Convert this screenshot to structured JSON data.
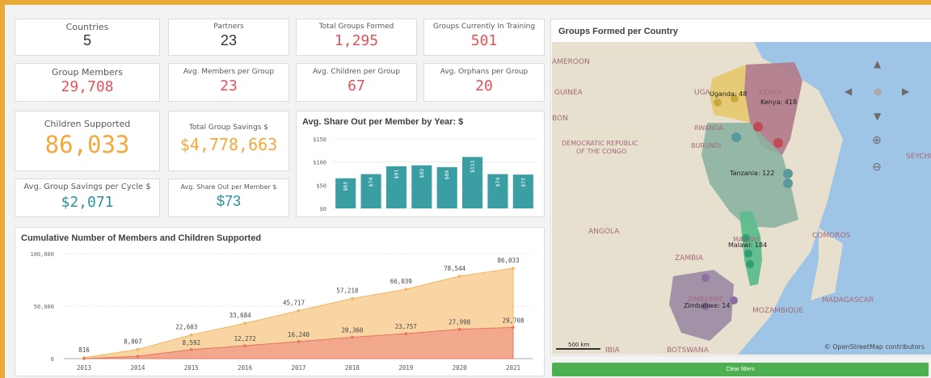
{
  "kpis": {
    "countries": {
      "label": "Countries",
      "value": "5"
    },
    "partners": {
      "label": "Partners",
      "value": "23"
    },
    "total_groups": {
      "label": "Total Groups Formed",
      "value": "1,295"
    },
    "groups_training": {
      "label": "Groups Currently In Training",
      "value": "501"
    },
    "group_members": {
      "label": "Group Members",
      "value": "29,708"
    },
    "avg_members": {
      "label": "Avg. Members per Group",
      "value": "23"
    },
    "avg_children": {
      "label": "Avg. Children per Group",
      "value": "67"
    },
    "avg_orphans": {
      "label": "Avg. Orphans per Group",
      "value": "20"
    },
    "children_supported": {
      "label": "Children Supported",
      "value": "86,033"
    },
    "total_savings": {
      "label": "Total Group Savings $",
      "value": "$4,778,663"
    },
    "avg_savings_cycle": {
      "label": "Avg. Group Savings per Cycle $",
      "value": "$2,071"
    },
    "avg_share_out": {
      "label": "Avg. Share Out per Member $",
      "value": "$73"
    }
  },
  "colors": {
    "red": "#e0535a",
    "orange": "#f2a93b",
    "teal": "#2f8f9a",
    "bar": "#3a9ea3"
  },
  "chart_data": [
    {
      "type": "bar",
      "title": "Avg. Share Out per Member by Year: $",
      "ylim": [
        0,
        150
      ],
      "yticks": [
        "$0",
        "$50",
        "$100",
        "$150"
      ],
      "values": [
        65,
        74,
        91,
        93,
        89,
        111,
        74,
        73
      ],
      "value_labels": [
        "$65",
        "$74",
        "$91",
        "$93",
        "$89",
        "$111",
        "$74",
        "$73"
      ]
    },
    {
      "type": "area",
      "title": "Cumulative Number of Members and Children Supported",
      "categories": [
        "2013",
        "2014",
        "2015",
        "2016",
        "2017",
        "2018",
        "2019",
        "2020",
        "2021"
      ],
      "ylim": [
        0,
        100000
      ],
      "yticks": [
        "0",
        "50,000",
        "100,000"
      ],
      "series": [
        {
          "values": [
            816,
            8807,
            22603,
            33684,
            45717,
            57218,
            66039,
            78544,
            86033
          ],
          "labels": [
            "816",
            "8,807",
            "22,603",
            "33,684",
            "45,717",
            "57,218",
            "66,039",
            "78,544",
            "86,033"
          ]
        },
        {
          "values": [
            0,
            2200,
            8592,
            12272,
            16240,
            20360,
            23757,
            27998,
            29708
          ],
          "labels": [
            "",
            "",
            "8,592",
            "12,272",
            "16,240",
            "20,360",
            "23,757",
            "27,998",
            "29,708"
          ]
        }
      ]
    }
  ],
  "map": {
    "title": "Groups Formed per Country",
    "place_labels": [
      "AMEROON",
      "GUINEA",
      "BON",
      "DEMOCRATIC REPUBLIC",
      "OF THE CONGO",
      "UGA",
      "KENYA",
      "RWANDA",
      "BURUNDI",
      "ANGOLA",
      "ZAMBIA",
      "MALAWI",
      "COMOROS",
      "ZIMBABWE",
      "MOZAMBIQUE",
      "MADAGASCAR",
      "BOTSWANA",
      "IBIA",
      "SEYCHI"
    ],
    "country_labels": [
      "Uganda: 48",
      "Kenya: 418",
      "Tanzania: 122",
      "Malawi: 184",
      "Zimbabwe: 14"
    ],
    "scale": "500 km",
    "attribution": "© OpenStreetMap contributors",
    "clear_filters": "Clear filters"
  }
}
